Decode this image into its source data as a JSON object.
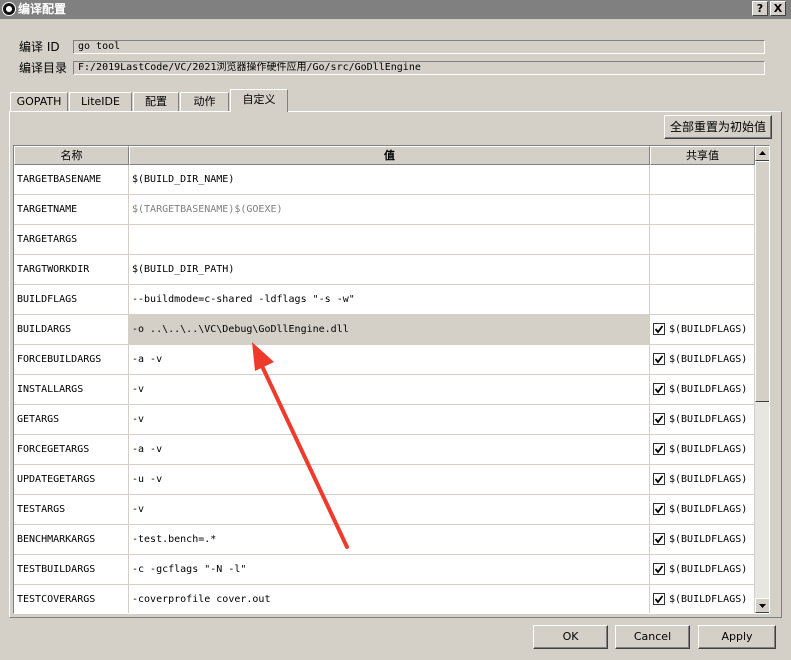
{
  "window": {
    "title": "编译配置",
    "help_label": "?",
    "close_label": "X"
  },
  "info": {
    "build_id_label": "编译 ID",
    "build_id_value": "go tool",
    "build_dir_label": "编译目录",
    "build_dir_value": "F:/2019LastCode/VC/2021浏览器操作硬件应用/Go/src/GoDllEngine"
  },
  "tabs": [
    "GOPATH",
    "LiteIDE",
    "配置",
    "动作",
    "自定义"
  ],
  "active_tab": "自定义",
  "reset_button": "全部重置为初始值",
  "table": {
    "columns": [
      "名称",
      "值",
      "共享值"
    ],
    "rows": [
      {
        "name": "TARGETBASENAME",
        "value": "$(BUILD_DIR_NAME)",
        "value_gray": false,
        "checked": null,
        "shared": ""
      },
      {
        "name": "TARGETNAME",
        "value": "$(TARGETBASENAME)$(GOEXE)",
        "value_gray": true,
        "checked": null,
        "shared": ""
      },
      {
        "name": "TARGETARGS",
        "value": "",
        "value_gray": false,
        "checked": null,
        "shared": ""
      },
      {
        "name": "TARGTWORKDIR",
        "value": "$(BUILD_DIR_PATH)",
        "value_gray": false,
        "checked": null,
        "shared": ""
      },
      {
        "name": "BUILDFLAGS",
        "value": "--buildmode=c-shared   -ldflags \"-s -w\"",
        "value_gray": false,
        "checked": null,
        "shared": ""
      },
      {
        "name": "BUILDARGS",
        "value": "-o ..\\..\\..\\VC\\Debug\\GoDllEngine.dll",
        "value_gray": false,
        "checked": true,
        "shared": "$(BUILDFLAGS)"
      },
      {
        "name": "FORCEBUILDARGS",
        "value": "-a -v",
        "value_gray": false,
        "checked": true,
        "shared": "$(BUILDFLAGS)"
      },
      {
        "name": "INSTALLARGS",
        "value": "-v",
        "value_gray": false,
        "checked": true,
        "shared": "$(BUILDFLAGS)"
      },
      {
        "name": "GETARGS",
        "value": "-v",
        "value_gray": false,
        "checked": true,
        "shared": "$(BUILDFLAGS)"
      },
      {
        "name": "FORCEGETARGS",
        "value": "-a -v",
        "value_gray": false,
        "checked": true,
        "shared": "$(BUILDFLAGS)"
      },
      {
        "name": "UPDATEGETARGS",
        "value": "-u -v",
        "value_gray": false,
        "checked": true,
        "shared": "$(BUILDFLAGS)"
      },
      {
        "name": "TESTARGS",
        "value": "-v",
        "value_gray": false,
        "checked": true,
        "shared": "$(BUILDFLAGS)"
      },
      {
        "name": "BENCHMARKARGS",
        "value": "-test.bench=.*",
        "value_gray": false,
        "checked": true,
        "shared": "$(BUILDFLAGS)"
      },
      {
        "name": "TESTBUILDARGS",
        "value": "-c -gcflags \"-N -l\"",
        "value_gray": false,
        "checked": true,
        "shared": "$(BUILDFLAGS)"
      },
      {
        "name": "TESTCOVERARGS",
        "value": "-coverprofile cover.out",
        "value_gray": false,
        "checked": true,
        "shared": "$(BUILDFLAGS)"
      }
    ]
  },
  "buttons": {
    "ok": "OK",
    "cancel": "Cancel",
    "apply": "Apply"
  },
  "colors": {
    "annotation_arrow": "#ef3b2c",
    "title_bar": "#808080",
    "dialog_bg": "#d4d0c8"
  }
}
